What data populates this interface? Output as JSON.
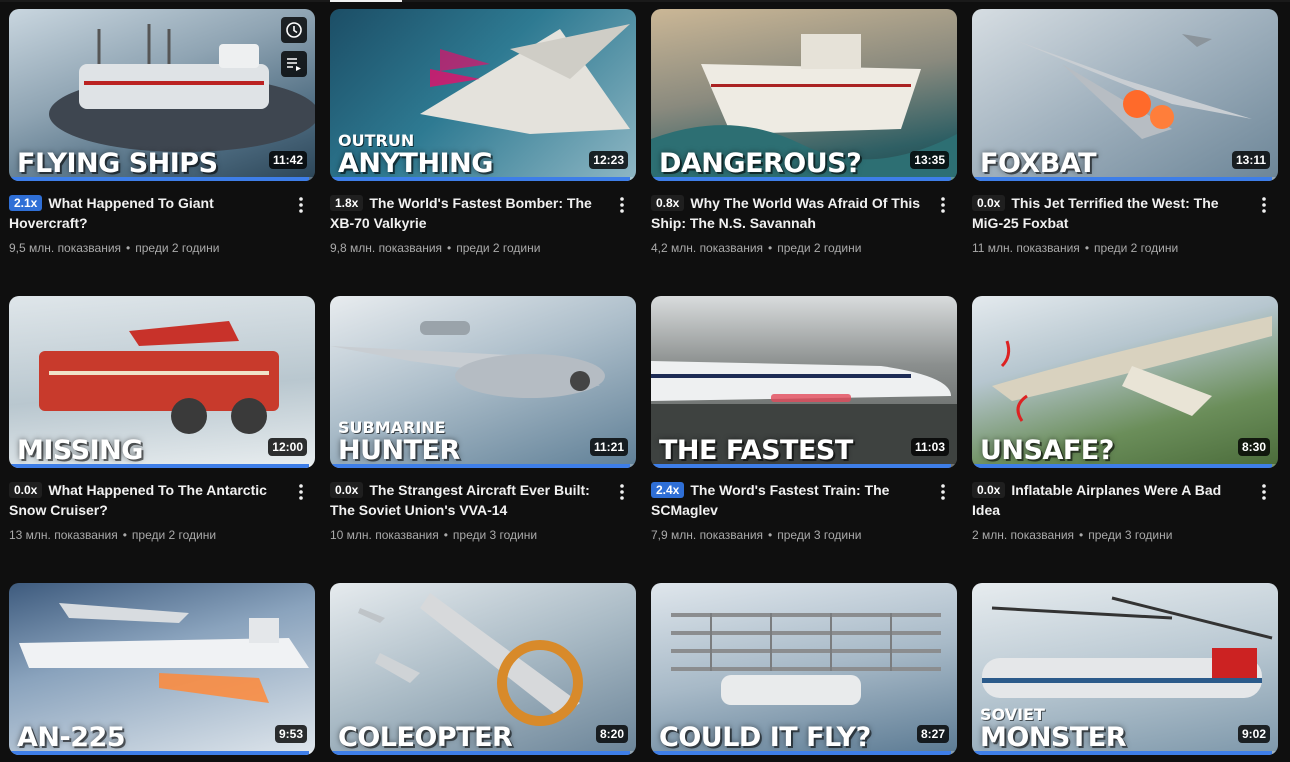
{
  "colors": {
    "background": "#0f0f0f",
    "progress": "#3e7ee8",
    "speed_badge_active": "#2f6fd6"
  },
  "thumb_icons": {
    "watch_later": "clock-icon",
    "add_to_queue": "queue-icon"
  },
  "videos": [
    {
      "overlay_sub": "",
      "overlay_title": "FLYING SHIPS",
      "duration": "11:42",
      "speed": "2.1x",
      "speed_active": true,
      "title": "What Happened To Giant Hovercraft?",
      "views": "9,5 млн. показвания",
      "age": "преди 2 години",
      "progress": 0.98
    },
    {
      "overlay_sub": "OUTRUN",
      "overlay_title": "ANYTHING",
      "duration": "12:23",
      "speed": "1.8x",
      "speed_active": false,
      "title": "The World's Fastest Bomber: The XB-70 Valkyrie",
      "views": "9,8 млн. показвания",
      "age": "преди 2 години",
      "progress": 0.98
    },
    {
      "overlay_sub": "",
      "overlay_title": "DANGEROUS?",
      "duration": "13:35",
      "speed": "0.8x",
      "speed_active": false,
      "title": "Why The World Was Afraid Of This Ship: The N.S. Savannah",
      "views": "4,2 млн. показвания",
      "age": "преди 2 години",
      "progress": 0.98
    },
    {
      "overlay_sub": "",
      "overlay_title": "FOXBAT",
      "duration": "13:11",
      "speed": "0.0x",
      "speed_active": false,
      "title": "This Jet Terrified the West: The MiG-25 Foxbat",
      "views": "11 млн. показвания",
      "age": "преди 2 години",
      "progress": 0.98
    },
    {
      "overlay_sub": "",
      "overlay_title": "MISSING",
      "duration": "12:00",
      "speed": "0.0x",
      "speed_active": false,
      "title": "What Happened To The Antarctic Snow Cruiser?",
      "views": "13 млн. показвания",
      "age": "преди 2 години",
      "progress": 0.98
    },
    {
      "overlay_sub": "SUBMARINE",
      "overlay_title": "HUNTER",
      "duration": "11:21",
      "speed": "0.0x",
      "speed_active": false,
      "title": "The Strangest Aircraft Ever Built: The Soviet Union's VVA-14",
      "views": "10 млн. показвания",
      "age": "преди 3 години",
      "progress": 0.98
    },
    {
      "overlay_sub": "",
      "overlay_title": "THE FASTEST",
      "duration": "11:03",
      "speed": "2.4x",
      "speed_active": true,
      "title": "The Word's Fastest Train: The SCMaglev",
      "views": "7,9 млн. показвания",
      "age": "преди 3 години",
      "progress": 0.98
    },
    {
      "overlay_sub": "",
      "overlay_title": "UNSAFE?",
      "duration": "8:30",
      "speed": "0.0x",
      "speed_active": false,
      "title": "Inflatable Airplanes Were A Bad Idea",
      "views": "2 млн. показвания",
      "age": "преди 3 години",
      "progress": 0.98
    },
    {
      "overlay_sub": "",
      "overlay_title": "AN-225",
      "duration": "9:53",
      "speed": "",
      "speed_active": false,
      "title": "",
      "views": "",
      "age": "",
      "progress": 0.98
    },
    {
      "overlay_sub": "",
      "overlay_title": "COLEOPTER",
      "duration": "8:20",
      "speed": "",
      "speed_active": false,
      "title": "",
      "views": "",
      "age": "",
      "progress": 0.98
    },
    {
      "overlay_sub": "",
      "overlay_title": "COULD IT FLY?",
      "duration": "8:27",
      "speed": "",
      "speed_active": false,
      "title": "",
      "views": "",
      "age": "",
      "progress": 0.98
    },
    {
      "overlay_sub": "SOVIET",
      "overlay_title": "MONSTER",
      "duration": "9:02",
      "speed": "",
      "speed_active": false,
      "title": "",
      "views": "",
      "age": "",
      "progress": 0.98
    }
  ]
}
